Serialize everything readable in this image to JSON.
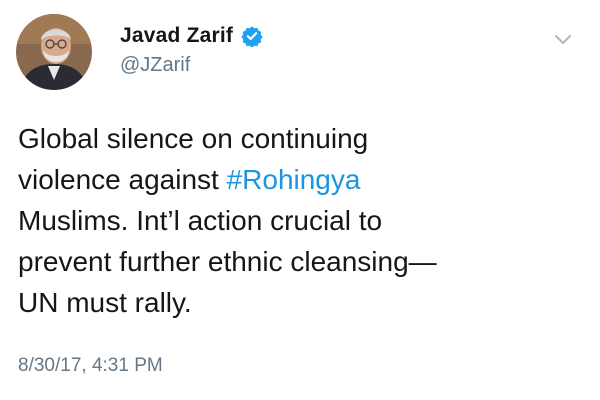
{
  "author": {
    "display_name": "Javad Zarif",
    "handle": "@JZarif",
    "verified": true,
    "avatar_icon": "profile-photo"
  },
  "tweet": {
    "lines": [
      {
        "before": "Global silence on continuing",
        "hashtag": "",
        "after": ""
      },
      {
        "before": "violence against ",
        "hashtag": "#Rohingya",
        "after": ""
      },
      {
        "before": "Muslims. Int’l action crucial to",
        "hashtag": "",
        "after": ""
      },
      {
        "before": "prevent further ethnic cleansing—",
        "hashtag": "",
        "after": ""
      },
      {
        "before": "UN must rally.",
        "hashtag": "",
        "after": ""
      }
    ],
    "timestamp": "8/30/17, 4:31 PM"
  },
  "colors": {
    "hashtag": "#1b95e0",
    "verified_badge": "#1da1f2",
    "secondary_text": "#657786",
    "primary_text": "#14171a"
  },
  "icons": {
    "verified": "verified-badge-icon",
    "menu": "chevron-down-icon"
  }
}
